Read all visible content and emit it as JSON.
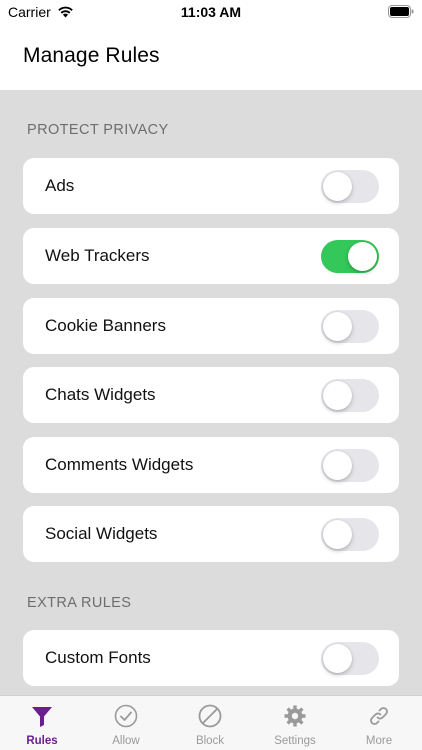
{
  "status_bar": {
    "carrier": "Carrier",
    "time": "11:03 AM"
  },
  "header": {
    "title": "Manage Rules"
  },
  "sections": [
    {
      "title": "PROTECT PRIVACY",
      "rules": [
        {
          "label": "Ads",
          "enabled": false
        },
        {
          "label": "Web Trackers",
          "enabled": true
        },
        {
          "label": "Cookie Banners",
          "enabled": false
        },
        {
          "label": "Chats Widgets",
          "enabled": false
        },
        {
          "label": "Comments Widgets",
          "enabled": false
        },
        {
          "label": "Social Widgets",
          "enabled": false
        }
      ]
    },
    {
      "title": "EXTRA RULES",
      "rules": [
        {
          "label": "Custom Fonts",
          "enabled": false
        }
      ]
    }
  ],
  "tabs": [
    {
      "label": "Rules",
      "icon": "funnel-icon",
      "active": true
    },
    {
      "label": "Allow",
      "icon": "checkmark-circle-icon",
      "active": false
    },
    {
      "label": "Block",
      "icon": "prohibited-icon",
      "active": false
    },
    {
      "label": "Settings",
      "icon": "gear-icon",
      "active": false
    },
    {
      "label": "More",
      "icon": "link-icon",
      "active": false
    }
  ],
  "colors": {
    "accent": "#6b1e8f",
    "toggle_on": "#34c759",
    "background": "#dcdcdc"
  }
}
